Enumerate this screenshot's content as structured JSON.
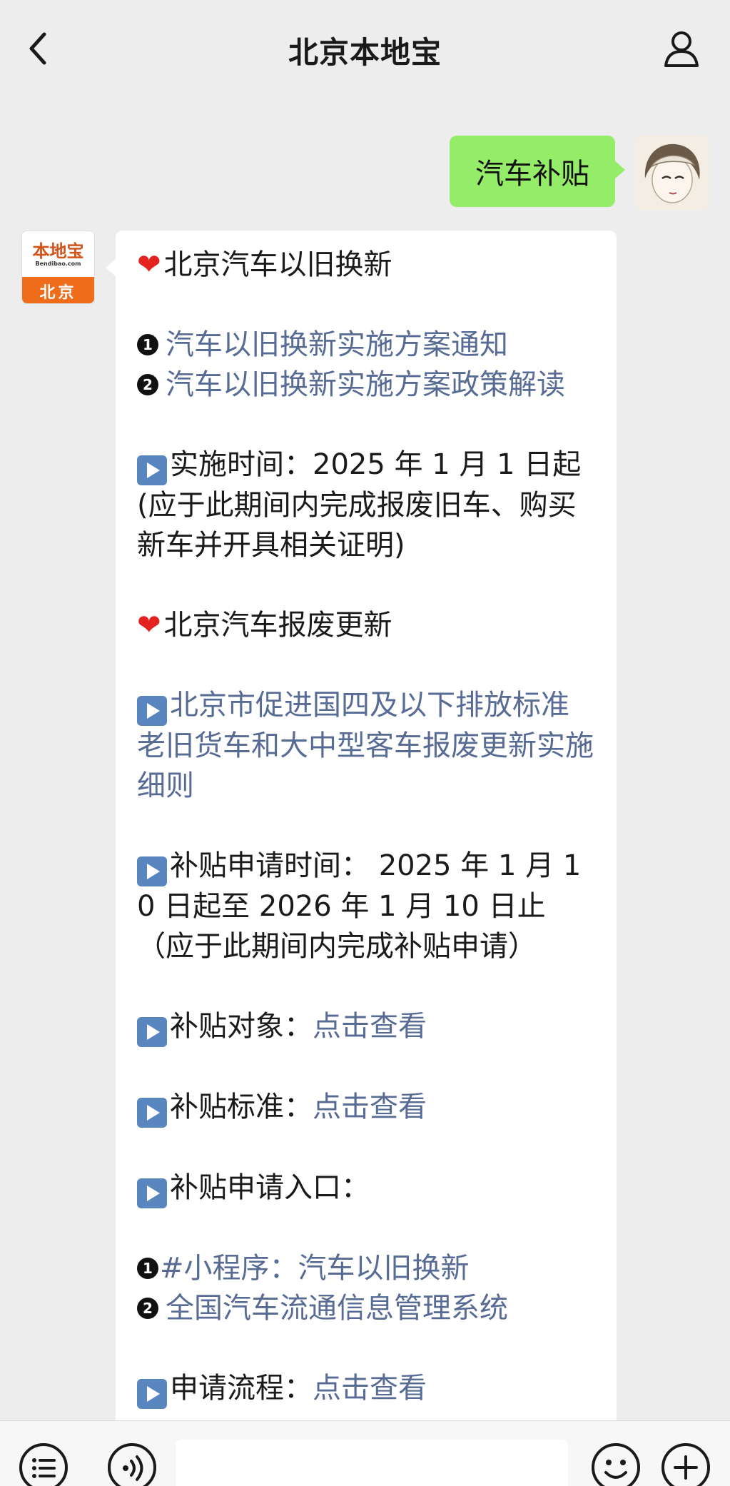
{
  "header": {
    "title": "北京本地宝"
  },
  "user_message": {
    "text": "汽车补贴"
  },
  "bot_avatar": {
    "brand": "本地宝",
    "domain": "Bendibao.com",
    "city": "北京"
  },
  "bot_message": {
    "section1_title": "北京汽车以旧换新",
    "link1_num": "❶",
    "link1": "汽车以旧换新实施方案通知",
    "link2_num": "❷",
    "link2": "汽车以旧换新实施方案政策解读",
    "impl_time": "实施时间：2025 年 1 月 1 日起",
    "impl_note": "(应于此期间内完成报废旧车、购买新车并开具相关证明)",
    "section2_title": "北京汽车报废更新",
    "rules_link": "北京市促进国四及以下排放标准老旧货车和大中型客车报废更新实施细则",
    "apply_time": "补贴申请时间： 2025 年 1 月 10 日起至 2026 年 1 月 10 日止（应于此期间内完成补贴申请）",
    "target_label": "补贴对象：",
    "target_link": "点击查看",
    "standard_label": "补贴标准：",
    "standard_link": "点击查看",
    "entry_label": "补贴申请入口：",
    "entry1_num": "❶",
    "entry1": "#小程序：汽车以旧换新",
    "entry2_num": "❷",
    "entry2": "全国汽车流通信息管理系统",
    "process_label": "申请流程：",
    "process_link": "点击查看"
  },
  "icons": {
    "back": "chevron-left-icon",
    "profile": "person-icon",
    "heart": "heart-icon",
    "play": "play-icon",
    "menu": "list-icon",
    "voice": "voice-icon",
    "emoji": "emoji-icon",
    "plus": "plus-icon"
  },
  "colors": {
    "user_bubble": "#95ec69",
    "link": "#576b95",
    "heart": "#e4231f",
    "play": "#5a86c0",
    "brand_orange": "#ef6c1a"
  }
}
